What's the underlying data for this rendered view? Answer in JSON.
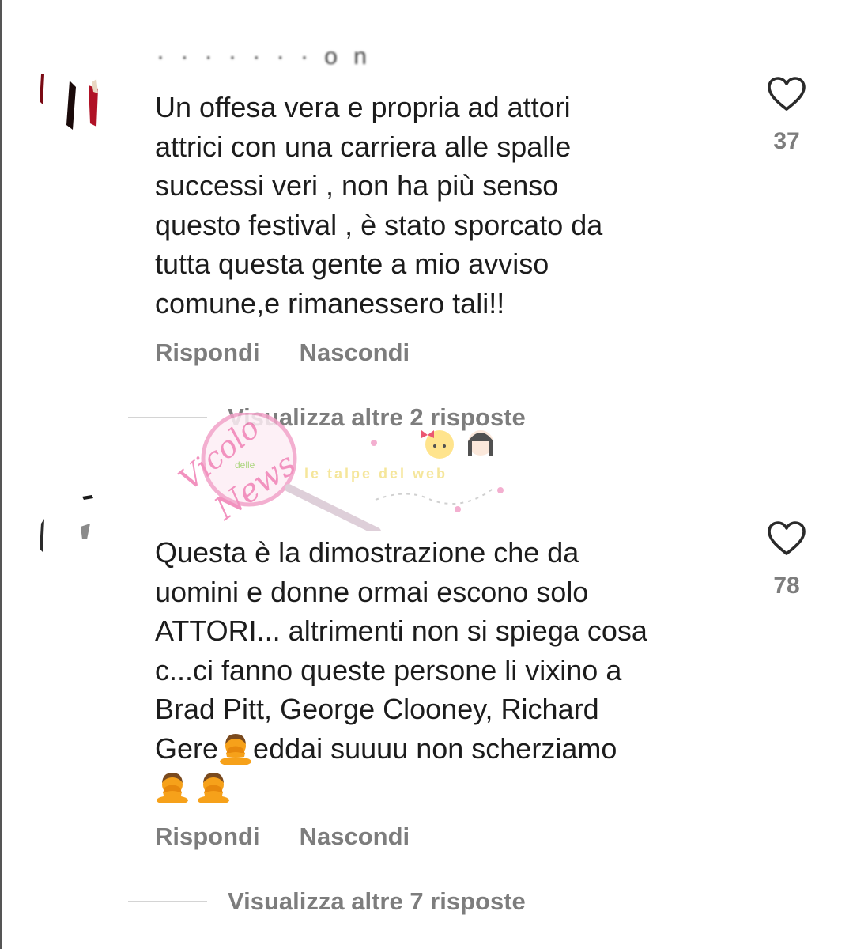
{
  "comments": [
    {
      "username": "· · · · · · · o n",
      "text": "Un offesa vera e propria ad attori\nattrici con una carriera alle spalle\nsuccessi veri , non ha più senso\nquesto festival , è stato sporcato da\ntutta questa gente a mio avviso\ncomune,e rimanessero tali!!",
      "likes": "37",
      "reply_label": "Rispondi",
      "hide_label": "Nascondi",
      "view_replies": "Visualizza altre 2 risposte"
    },
    {
      "username": "",
      "text_lines": [
        "Questa è la dimostrazione che da",
        "uomini e donne ormai escono solo",
        "ATTORI... altrimenti non si spiega cosa",
        "c...ci fanno queste persone li vixino a",
        "Brad Pitt, George Clooney, Richard"
      ],
      "text_line6_before": "Gere",
      "text_line6_after": "eddai suuuu non scherziamo",
      "likes": "78",
      "reply_label": "Rispondi",
      "hide_label": "Nascondi",
      "view_replies": "Visualizza altre 7 risposte"
    }
  ],
  "watermark": {
    "main": "Vicolo",
    "delle": "delle",
    "news": "News",
    "tagline": "le talpe del web"
  },
  "icons": {
    "like": "heart-outline-icon",
    "emoji": "person-facepalming-emoji"
  },
  "colors": {
    "text": "#1c1c1c",
    "secondary": "#7d7d7d",
    "divider": "#d4d4d4",
    "emoji_skin": "#f6a11a",
    "emoji_hair": "#7a4a1e",
    "watermark_pink": "#f2a2c8"
  }
}
